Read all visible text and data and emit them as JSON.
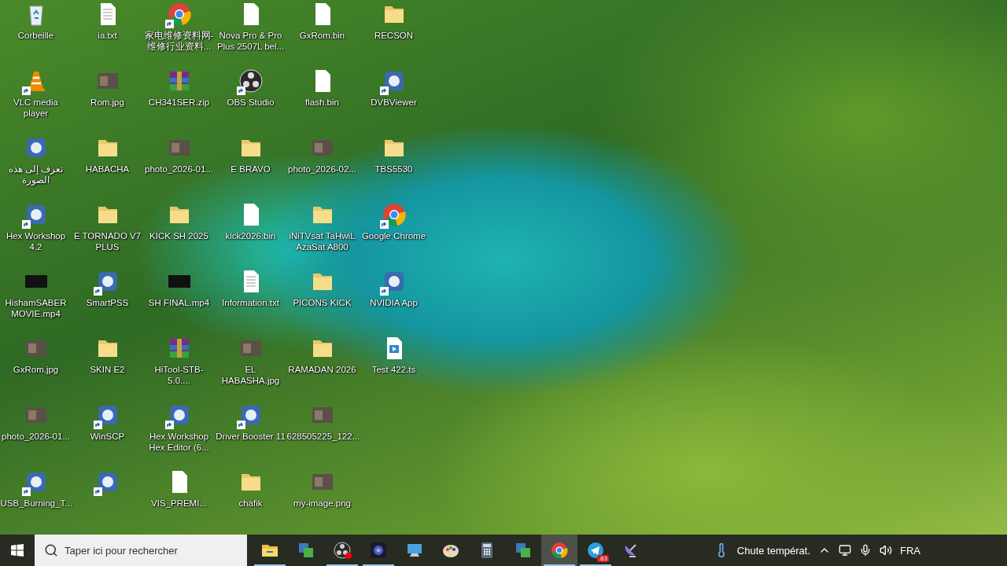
{
  "desktop": {
    "icons": [
      {
        "label": "Corbeille",
        "kind": "recycle",
        "shortcut": false
      },
      {
        "label": "ia.txt",
        "kind": "text",
        "shortcut": false
      },
      {
        "label": "家电维修资料网-维修行业资料...",
        "kind": "chrome",
        "shortcut": true
      },
      {
        "label": "Nova Pro & Pro Plus 2507L bel...",
        "kind": "blank",
        "shortcut": false
      },
      {
        "label": "GxRom.bin",
        "kind": "blank",
        "shortcut": false
      },
      {
        "label": "RECSON",
        "kind": "folder",
        "shortcut": false
      },
      {
        "label": "VLC media player",
        "kind": "vlc",
        "shortcut": true
      },
      {
        "label": "Rom.jpg",
        "kind": "image",
        "shortcut": false
      },
      {
        "label": "CH341SER.zip",
        "kind": "archive",
        "shortcut": false
      },
      {
        "label": "OBS Studio",
        "kind": "obs",
        "shortcut": true
      },
      {
        "label": "flash.bin",
        "kind": "blank",
        "shortcut": false
      },
      {
        "label": "DVBViewer",
        "kind": "app",
        "shortcut": true
      },
      {
        "label": "تعرف إلى هذه الصورة",
        "kind": "app",
        "shortcut": false
      },
      {
        "label": "HABACHA",
        "kind": "folder",
        "shortcut": false
      },
      {
        "label": "photo_2026-01...",
        "kind": "image",
        "shortcut": false
      },
      {
        "label": "E BRAVO",
        "kind": "folder",
        "shortcut": false
      },
      {
        "label": "photo_2026-02...",
        "kind": "image",
        "shortcut": false
      },
      {
        "label": "TBS5530",
        "kind": "folder",
        "shortcut": false
      },
      {
        "label": "Hex Workshop 4.2",
        "kind": "app",
        "shortcut": true
      },
      {
        "label": "E TORNADO V7 PLUS",
        "kind": "folder",
        "shortcut": false
      },
      {
        "label": "KICK SH 2025",
        "kind": "folder",
        "shortcut": false
      },
      {
        "label": "kick2026.bin",
        "kind": "blank",
        "shortcut": false
      },
      {
        "label": "iNiTVsat TaHwiL AzaSat A800",
        "kind": "folder",
        "shortcut": false
      },
      {
        "label": "Google Chrome",
        "kind": "chrome",
        "shortcut": true
      },
      {
        "label": "HishamSABER MOVIE.mp4",
        "kind": "video",
        "shortcut": false
      },
      {
        "label": "SmartPSS",
        "kind": "app",
        "shortcut": true
      },
      {
        "label": "SH FINAL.mp4",
        "kind": "video",
        "shortcut": false
      },
      {
        "label": "Information.txt",
        "kind": "text",
        "shortcut": false
      },
      {
        "label": "PICONS KICK",
        "kind": "folder",
        "shortcut": false
      },
      {
        "label": "NVIDIA App",
        "kind": "app",
        "shortcut": true
      },
      {
        "label": "GxRom.jpg",
        "kind": "image",
        "shortcut": false
      },
      {
        "label": "SKIN E2",
        "kind": "folder",
        "shortcut": false
      },
      {
        "label": "HiTool-STB-5.0....",
        "kind": "archive",
        "shortcut": false
      },
      {
        "label": "EL HABASHA.jpg",
        "kind": "image",
        "shortcut": false
      },
      {
        "label": "RAMADAN 2026",
        "kind": "folder",
        "shortcut": false
      },
      {
        "label": "Test 422.ts",
        "kind": "media",
        "shortcut": false
      },
      {
        "label": "photo_2026-01...",
        "kind": "image",
        "shortcut": false
      },
      {
        "label": "WinSCP",
        "kind": "app",
        "shortcut": true
      },
      {
        "label": "Hex Workshop Hex Editor (6...",
        "kind": "app",
        "shortcut": true
      },
      {
        "label": "Driver Booster 11",
        "kind": "app",
        "shortcut": true
      },
      {
        "label": "628505225_122...",
        "kind": "image",
        "shortcut": false
      },
      {
        "kind": "empty"
      },
      {
        "label": "USB_Burning_T...",
        "kind": "app",
        "shortcut": true
      },
      {
        "kind": "app",
        "shortcut": true
      },
      {
        "label": "VIS_PREMI...",
        "kind": "blank",
        "shortcut": false
      },
      {
        "label": "chafik",
        "kind": "folder",
        "shortcut": false
      },
      {
        "label": "my-image.png",
        "kind": "image",
        "shortcut": false
      },
      {
        "kind": "empty"
      }
    ]
  },
  "taskbar": {
    "search": {
      "placeholder": "Taper ici pour rechercher"
    },
    "apps": [
      {
        "kind": "explorer",
        "running": true,
        "selected": false
      },
      {
        "kind": "app",
        "running": false,
        "selected": false
      },
      {
        "kind": "obs",
        "running": true,
        "selected": false,
        "recording": true
      },
      {
        "kind": "camera",
        "running": true,
        "selected": false
      },
      {
        "kind": "computer",
        "running": false,
        "selected": false
      },
      {
        "kind": "paint",
        "running": false,
        "selected": false
      },
      {
        "kind": "calculator",
        "running": false,
        "selected": false
      },
      {
        "kind": "app",
        "running": false,
        "selected": false
      },
      {
        "kind": "chrome",
        "running": true,
        "selected": true
      },
      {
        "kind": "telegram",
        "running": true,
        "selected": false,
        "badge": ".83"
      },
      {
        "kind": "satellite",
        "running": false,
        "selected": false
      }
    ],
    "weather": "Chute températ.",
    "language": "FRA"
  }
}
